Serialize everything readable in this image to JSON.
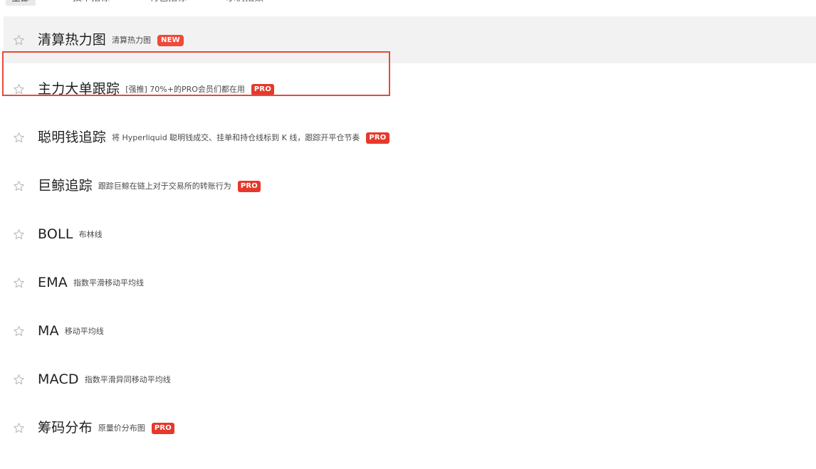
{
  "tabs": [
    {
      "label": "全部",
      "active": true
    },
    {
      "label": "技术指标",
      "active": false
    },
    {
      "label": "特色指标",
      "active": false
    },
    {
      "label": "示例指数",
      "active": false
    }
  ],
  "indicators": [
    {
      "name": "清算热力图",
      "description": "清算热力图",
      "badge": "NEW",
      "state": "hover"
    },
    {
      "name": "主力大单跟踪",
      "description": "[强推] 70%+的PRO会员们都在用",
      "badge": "PRO",
      "state": "selected"
    },
    {
      "name": "聪明钱追踪",
      "description": "将 Hyperliquid 聪明钱成交、挂单和持仓线标到 K 线，跟踪开平仓节奏",
      "badge": "PRO",
      "state": "normal"
    },
    {
      "name": "巨鲸追踪",
      "description": "跟踪巨鲸在链上对于交易所的转账行为",
      "badge": "PRO",
      "state": "normal"
    },
    {
      "name": "BOLL",
      "description": "布林线",
      "badge": "",
      "state": "normal"
    },
    {
      "name": "EMA",
      "description": "指数平滑移动平均线",
      "badge": "",
      "state": "normal"
    },
    {
      "name": "MA",
      "description": "移动平均线",
      "badge": "",
      "state": "normal"
    },
    {
      "name": "MACD",
      "description": "指数平滑异同移动平均线",
      "badge": "",
      "state": "normal"
    },
    {
      "name": "筹码分布",
      "description": "原量价分布图",
      "badge": "PRO",
      "state": "normal"
    }
  ],
  "colors": {
    "badge_red": "#e5392b",
    "selection_border": "#e64a3c",
    "hover_background": "#f2f2f2",
    "star_outline": "#b5b5b5"
  },
  "icons": {
    "favorite": "star-outline-icon"
  }
}
